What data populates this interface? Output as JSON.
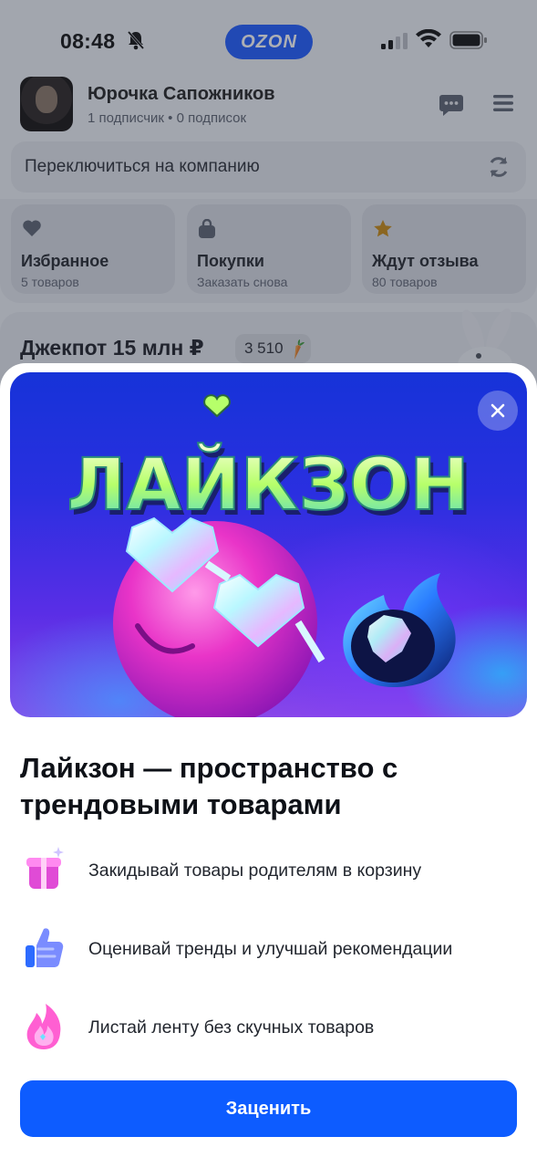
{
  "status_bar": {
    "time": "08:48",
    "brand_pill": "OZON"
  },
  "profile": {
    "name": "Юрочка Сапожников",
    "stats": "1 подписчик • 0 подписок"
  },
  "switch_company": {
    "label": "Переключиться на компанию"
  },
  "tiles": [
    {
      "title": "Избранное",
      "subtitle": "5 товаров",
      "icon": "heart-icon"
    },
    {
      "title": "Покупки",
      "subtitle": "Заказать снова",
      "icon": "bag-icon"
    },
    {
      "title": "Ждут отзыва",
      "subtitle": "80 товаров",
      "icon": "star-icon"
    }
  ],
  "jackpot": {
    "title": "Джекпот 15 млн ₽",
    "balance": "3 510"
  },
  "modal": {
    "banner_logo_text": "ЛАЙКЗОН",
    "headline": "Лайкзон — пространство с трендовыми товарами",
    "features": [
      {
        "text": "Закидывай товары родителям в корзину",
        "icon": "gift-box-icon"
      },
      {
        "text": "Оценивай тренды и улучшай рекомендации",
        "icon": "thumbs-up-icon"
      },
      {
        "text": "Листай ленту без скучных товаров",
        "icon": "flame-icon"
      }
    ],
    "cta_label": "Заценить"
  },
  "colors": {
    "brand_blue": "#0d5cff",
    "ozon_pill": "#1e5bff",
    "banner_top": "#1633d8",
    "banner_bottom": "#8a47e8"
  }
}
